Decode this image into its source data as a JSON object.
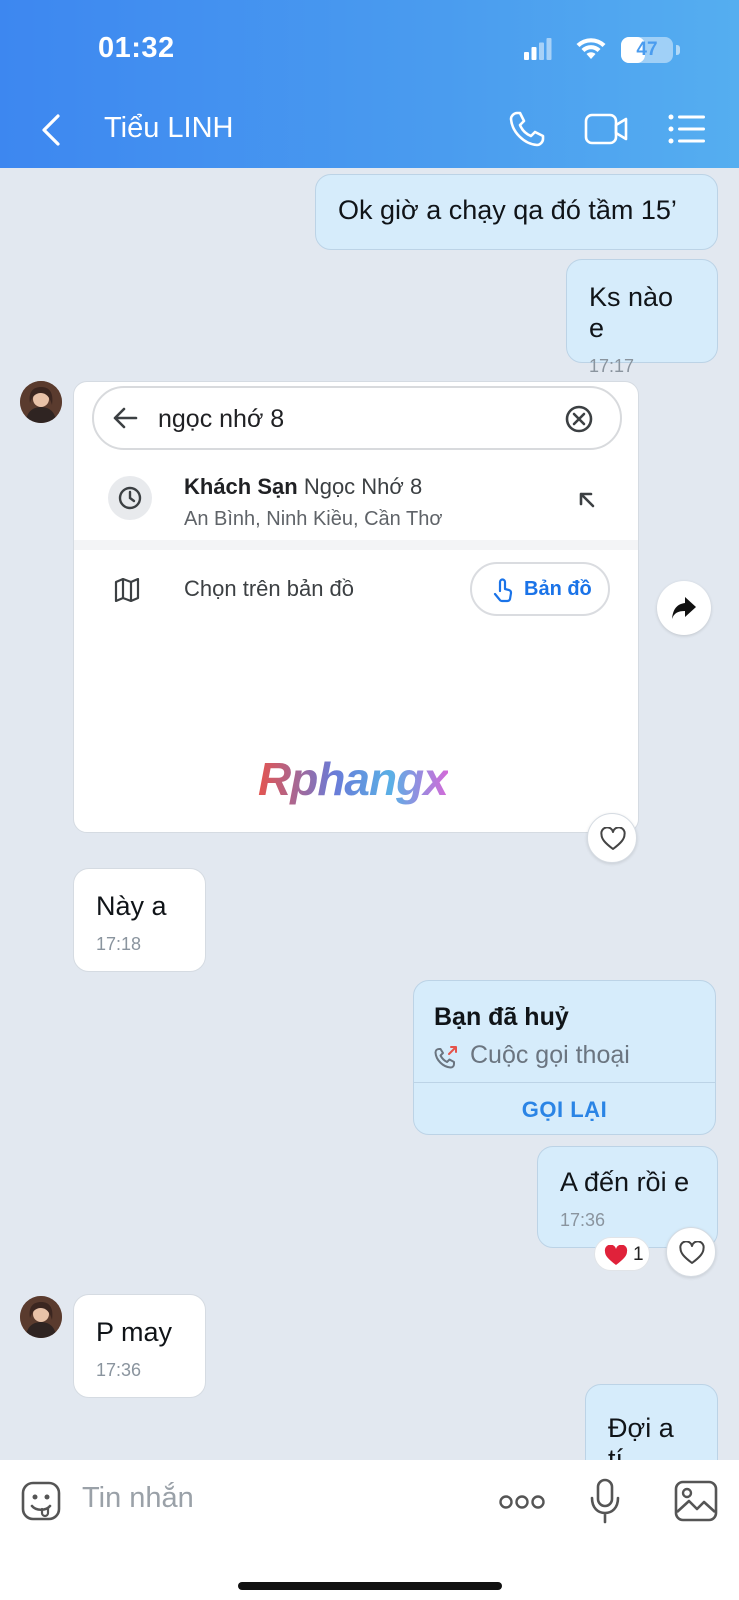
{
  "status_bar": {
    "time": "01:32",
    "battery": "47",
    "battery_level": 0.47
  },
  "header": {
    "contact_name": "Tiểu LINH",
    "icons": [
      "back-icon",
      "phone-icon",
      "video-camera-icon",
      "menu-list-icon"
    ]
  },
  "messages": [
    {
      "direction": "out",
      "text": "Ok giờ a chạy qa đó tầm 15’",
      "time": ""
    },
    {
      "direction": "out",
      "text": "Ks nào e",
      "time": "17:17"
    },
    {
      "direction": "in",
      "type": "shared-image"
    },
    {
      "direction": "in",
      "text": "Này a",
      "time": "17:18"
    },
    {
      "direction": "out",
      "type": "call"
    },
    {
      "direction": "out",
      "text": "A đến rồi e",
      "time": "17:36",
      "reaction_count": "1"
    },
    {
      "direction": "in",
      "text": "P may",
      "time": "17:36"
    },
    {
      "direction": "out",
      "text": "Đợi a tí",
      "time": ""
    }
  ],
  "shared_card": {
    "search_query": "ngọc nhớ 8",
    "result_bold": "Khách Sạn",
    "result_rest": "Ngọc Nhớ 8",
    "result_address": "An Bình, Ninh Kiều, Cần Thơ",
    "map_label": "Chọn trên bản đồ",
    "map_button": "Bản đồ",
    "watermark": "Rphangx"
  },
  "call_card": {
    "title": "Bạn đã huỷ",
    "subtitle": "Cuộc gọi thoại",
    "action": "GỌI LẠI"
  },
  "input": {
    "placeholder": "Tin nhắn"
  },
  "colors": {
    "header_gradient_start": "#3d87f0",
    "header_gradient_end": "#55aef0",
    "outgoing_bubble": "#d6ecfb",
    "incoming_bubble": "#ffffff",
    "chat_background": "#e2e8f0",
    "accent": "#2a84e5"
  }
}
